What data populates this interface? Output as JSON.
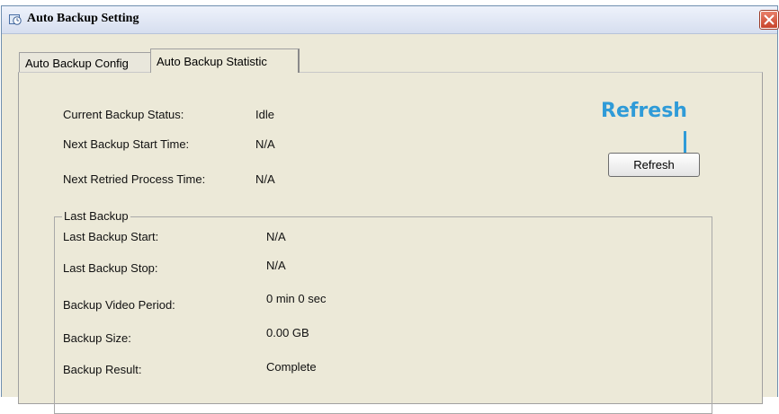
{
  "window": {
    "title": "Auto Backup Setting",
    "title_icon": "backup-clock-icon",
    "close_icon": "close-icon"
  },
  "tabs": [
    {
      "label": "Auto Backup Config",
      "active": false
    },
    {
      "label": "Auto Backup Statistic",
      "active": true
    }
  ],
  "status": {
    "current_backup_status_label": "Current Backup Status:",
    "current_backup_status_value": "Idle",
    "next_backup_start_time_label": "Next Backup Start Time:",
    "next_backup_start_time_value": "N/A",
    "next_retried_process_time_label": "Next Retried Process Time:",
    "next_retried_process_time_value": "N/A"
  },
  "last_backup": {
    "legend": "Last Backup",
    "start_label": "Last Backup Start:",
    "start_value": "N/A",
    "stop_label": "Last Backup Stop:",
    "stop_value": "N/A",
    "video_period_label": "Backup Video Period:",
    "video_period_value": "0 min 0 sec",
    "size_label": "Backup Size:",
    "size_value": "0.00 GB",
    "result_label": "Backup Result:",
    "result_value": "Complete"
  },
  "refresh_button_label": "Refresh",
  "annotation": {
    "text": "Refresh",
    "color": "#2f9bd8"
  }
}
